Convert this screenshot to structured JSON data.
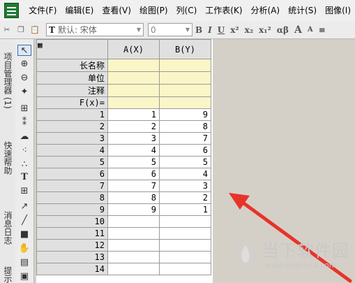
{
  "menu": {
    "items": [
      "文件(F)",
      "编辑(E)",
      "查看(V)",
      "绘图(P)",
      "列(C)",
      "工作表(K)",
      "分析(A)",
      "统计(S)",
      "图像(I)"
    ]
  },
  "toolbar": {
    "font_name": "默认: 宋体",
    "font_size": "0",
    "format_buttons": [
      "B",
      "I",
      "U",
      "x²",
      "x₂",
      "x₁²",
      "αβ",
      "A",
      "A",
      "≡"
    ]
  },
  "left_panel": {
    "tabs": [
      "项目管理器 (1)",
      "快速帮助",
      "消息日志",
      "提示"
    ]
  },
  "worksheet": {
    "columns": [
      "A(X)",
      "B(Y)"
    ],
    "meta_rows": [
      "长名称",
      "单位",
      "注释",
      "F(x)="
    ],
    "rows": [
      {
        "n": "1",
        "a": "1",
        "b": "9"
      },
      {
        "n": "2",
        "a": "2",
        "b": "8"
      },
      {
        "n": "3",
        "a": "3",
        "b": "7"
      },
      {
        "n": "4",
        "a": "4",
        "b": "6"
      },
      {
        "n": "5",
        "a": "5",
        "b": "5"
      },
      {
        "n": "6",
        "a": "6",
        "b": "4"
      },
      {
        "n": "7",
        "a": "7",
        "b": "3"
      },
      {
        "n": "8",
        "a": "8",
        "b": "2"
      },
      {
        "n": "9",
        "a": "9",
        "b": "1"
      },
      {
        "n": "10",
        "a": "",
        "b": ""
      },
      {
        "n": "11",
        "a": "",
        "b": ""
      },
      {
        "n": "12",
        "a": "",
        "b": ""
      },
      {
        "n": "13",
        "a": "",
        "b": ""
      },
      {
        "n": "14",
        "a": "",
        "b": ""
      }
    ]
  },
  "watermark": {
    "text": "当下软件园",
    "url": "www.downxia.com"
  },
  "colors": {
    "meta_fill": "#fbf6c7",
    "annotation_arrow": "#e8332a"
  }
}
